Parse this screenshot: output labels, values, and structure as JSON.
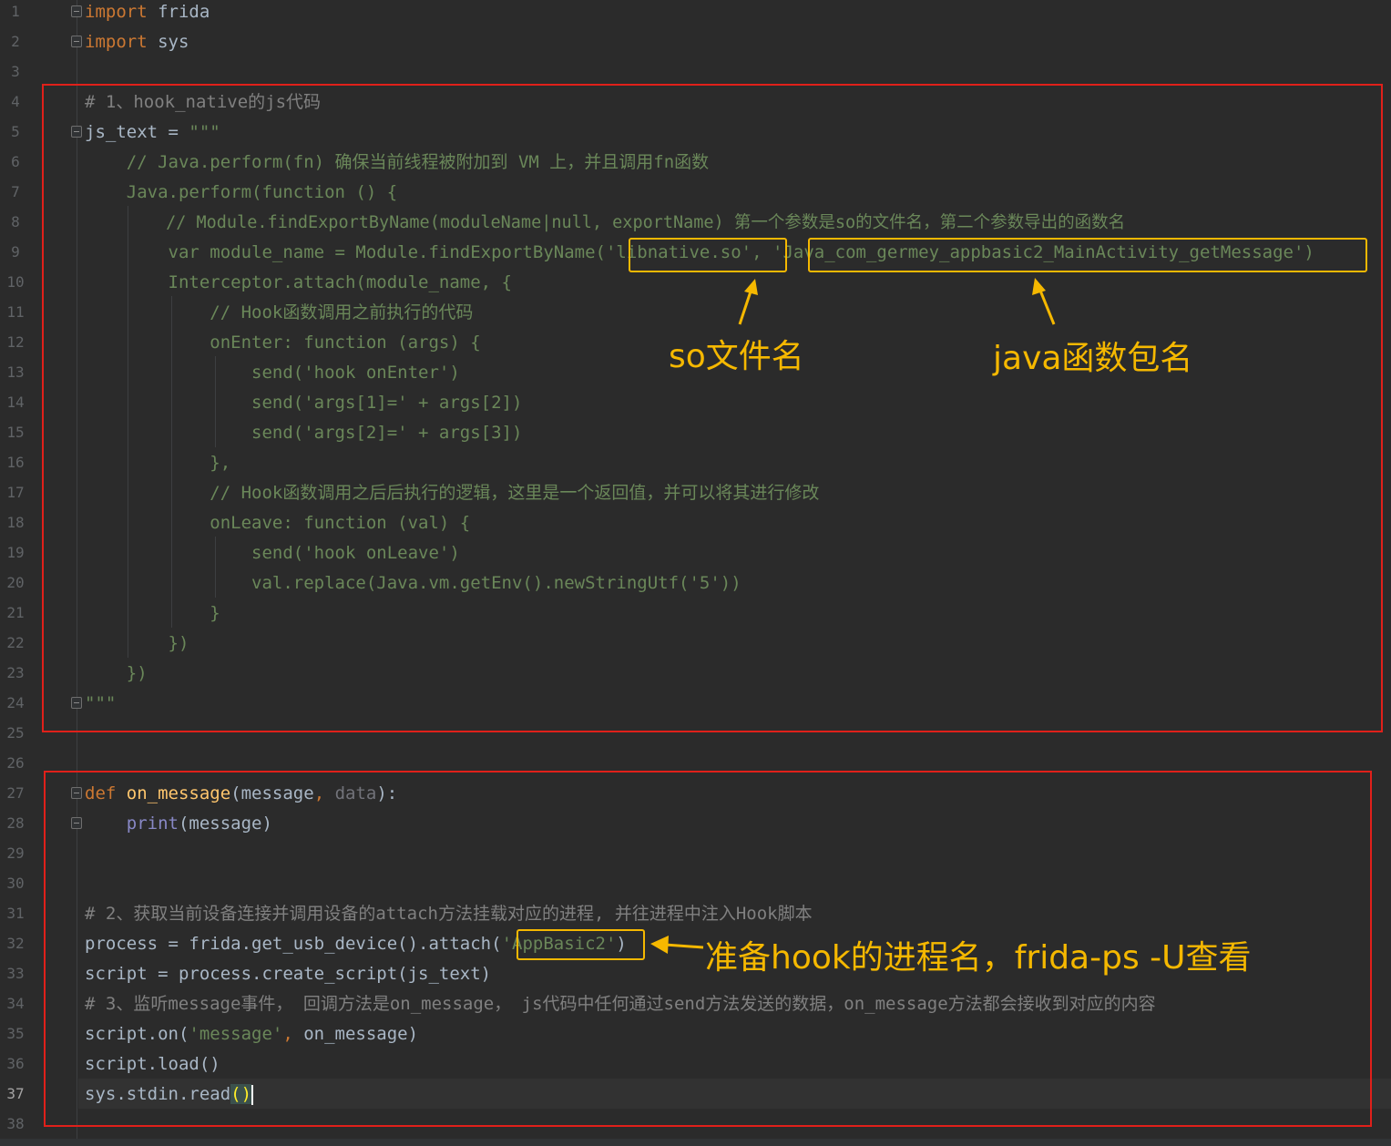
{
  "editor": {
    "language": "python",
    "current_line": 37,
    "lines": [
      {
        "n": "1"
      },
      {
        "n": "2"
      },
      {
        "n": "3"
      },
      {
        "n": "4"
      },
      {
        "n": "5"
      },
      {
        "n": "6"
      },
      {
        "n": "7"
      },
      {
        "n": "8"
      },
      {
        "n": "9"
      },
      {
        "n": "10"
      },
      {
        "n": "11"
      },
      {
        "n": "12"
      },
      {
        "n": "13"
      },
      {
        "n": "14"
      },
      {
        "n": "15"
      },
      {
        "n": "16"
      },
      {
        "n": "17"
      },
      {
        "n": "18"
      },
      {
        "n": "19"
      },
      {
        "n": "20"
      },
      {
        "n": "21"
      },
      {
        "n": "22"
      },
      {
        "n": "23"
      },
      {
        "n": "24"
      },
      {
        "n": "25"
      },
      {
        "n": "26"
      },
      {
        "n": "27"
      },
      {
        "n": "28"
      },
      {
        "n": "29"
      },
      {
        "n": "30"
      },
      {
        "n": "31"
      },
      {
        "n": "32"
      },
      {
        "n": "33"
      },
      {
        "n": "34"
      },
      {
        "n": "35"
      },
      {
        "n": "36"
      },
      {
        "n": "37"
      },
      {
        "n": "38"
      }
    ],
    "code": {
      "l1_kw": "import",
      "l1_rest": " frida",
      "l2_kw": "import",
      "l2_rest": " sys",
      "l4": "# 1、hook_native的js代码",
      "l5_a": "js_text = ",
      "l5_b": "\"\"\"",
      "l6": "    // Java.perform(fn) 确保当前线程被附加到 VM 上，并且调用fn函数",
      "l7": "    Java.perform(function () {",
      "l8": "        // Module.findExportByName(moduleName|null, exportName) 第一个参数是so的文件名，第二个参数导出的函数名",
      "l9_a": "        var module_name = Module.findExportByName(",
      "l9_b": "'libnative.so'",
      "l9_c": ", ",
      "l9_d": "'Java_com_germey_appbasic2_MainActivity_getMessage'",
      "l9_e": ")",
      "l10": "        Interceptor.attach(module_name, {",
      "l11": "            // Hook函数调用之前执行的代码",
      "l12": "            onEnter: function (args) {",
      "l13": "                send('hook onEnter')",
      "l14": "                send('args[1]=' + args[2])",
      "l15": "                send('args[2]=' + args[3])",
      "l16": "            },",
      "l17": "            // Hook函数调用之后后执行的逻辑，这里是一个返回值，并可以将其进行修改",
      "l18": "            onLeave: function (val) {",
      "l19": "                send('hook onLeave')",
      "l20": "                val.replace(Java.vm.getEnv().newStringUtf('5'))",
      "l21": "            }",
      "l22": "        })",
      "l23": "    })",
      "l24": "\"\"\"",
      "l27_kw": "def",
      "l27_fn": "on_message",
      "l27_a": "(message",
      "l27_comma": ",",
      "l27_data": " data",
      "l27_b": "):",
      "l28_pre": "    ",
      "l28_bi": "print",
      "l28_rest": "(message)",
      "l31": "# 2、获取当前设备连接并调用设备的attach方法挂载对应的进程, 并往进程中注入Hook脚本",
      "l32_a": "process = frida.get_usb_device().attach(",
      "l32_str": "'AppBasic2'",
      "l32_b": ")",
      "l33": "script = process.create_script(js_text)",
      "l34": "# 3、监听message事件， 回调方法是on_message， js代码中任何通过send方法发送的数据，on_message方法都会接收到对应的内容",
      "l35_a": "script.on(",
      "l35_str": "'message'",
      "l35_comma": ",",
      "l35_b": " on_message)",
      "l36": "script.load()",
      "l37_a": "sys.stdin.read",
      "l37_b": "()"
    }
  },
  "annotations": {
    "so_label": "so文件名",
    "java_label": "java函数包名",
    "process_label": "准备hook的进程名，frida-ps -U查看",
    "box_color": "#e0201a",
    "highlight_color": "#f5b800"
  }
}
